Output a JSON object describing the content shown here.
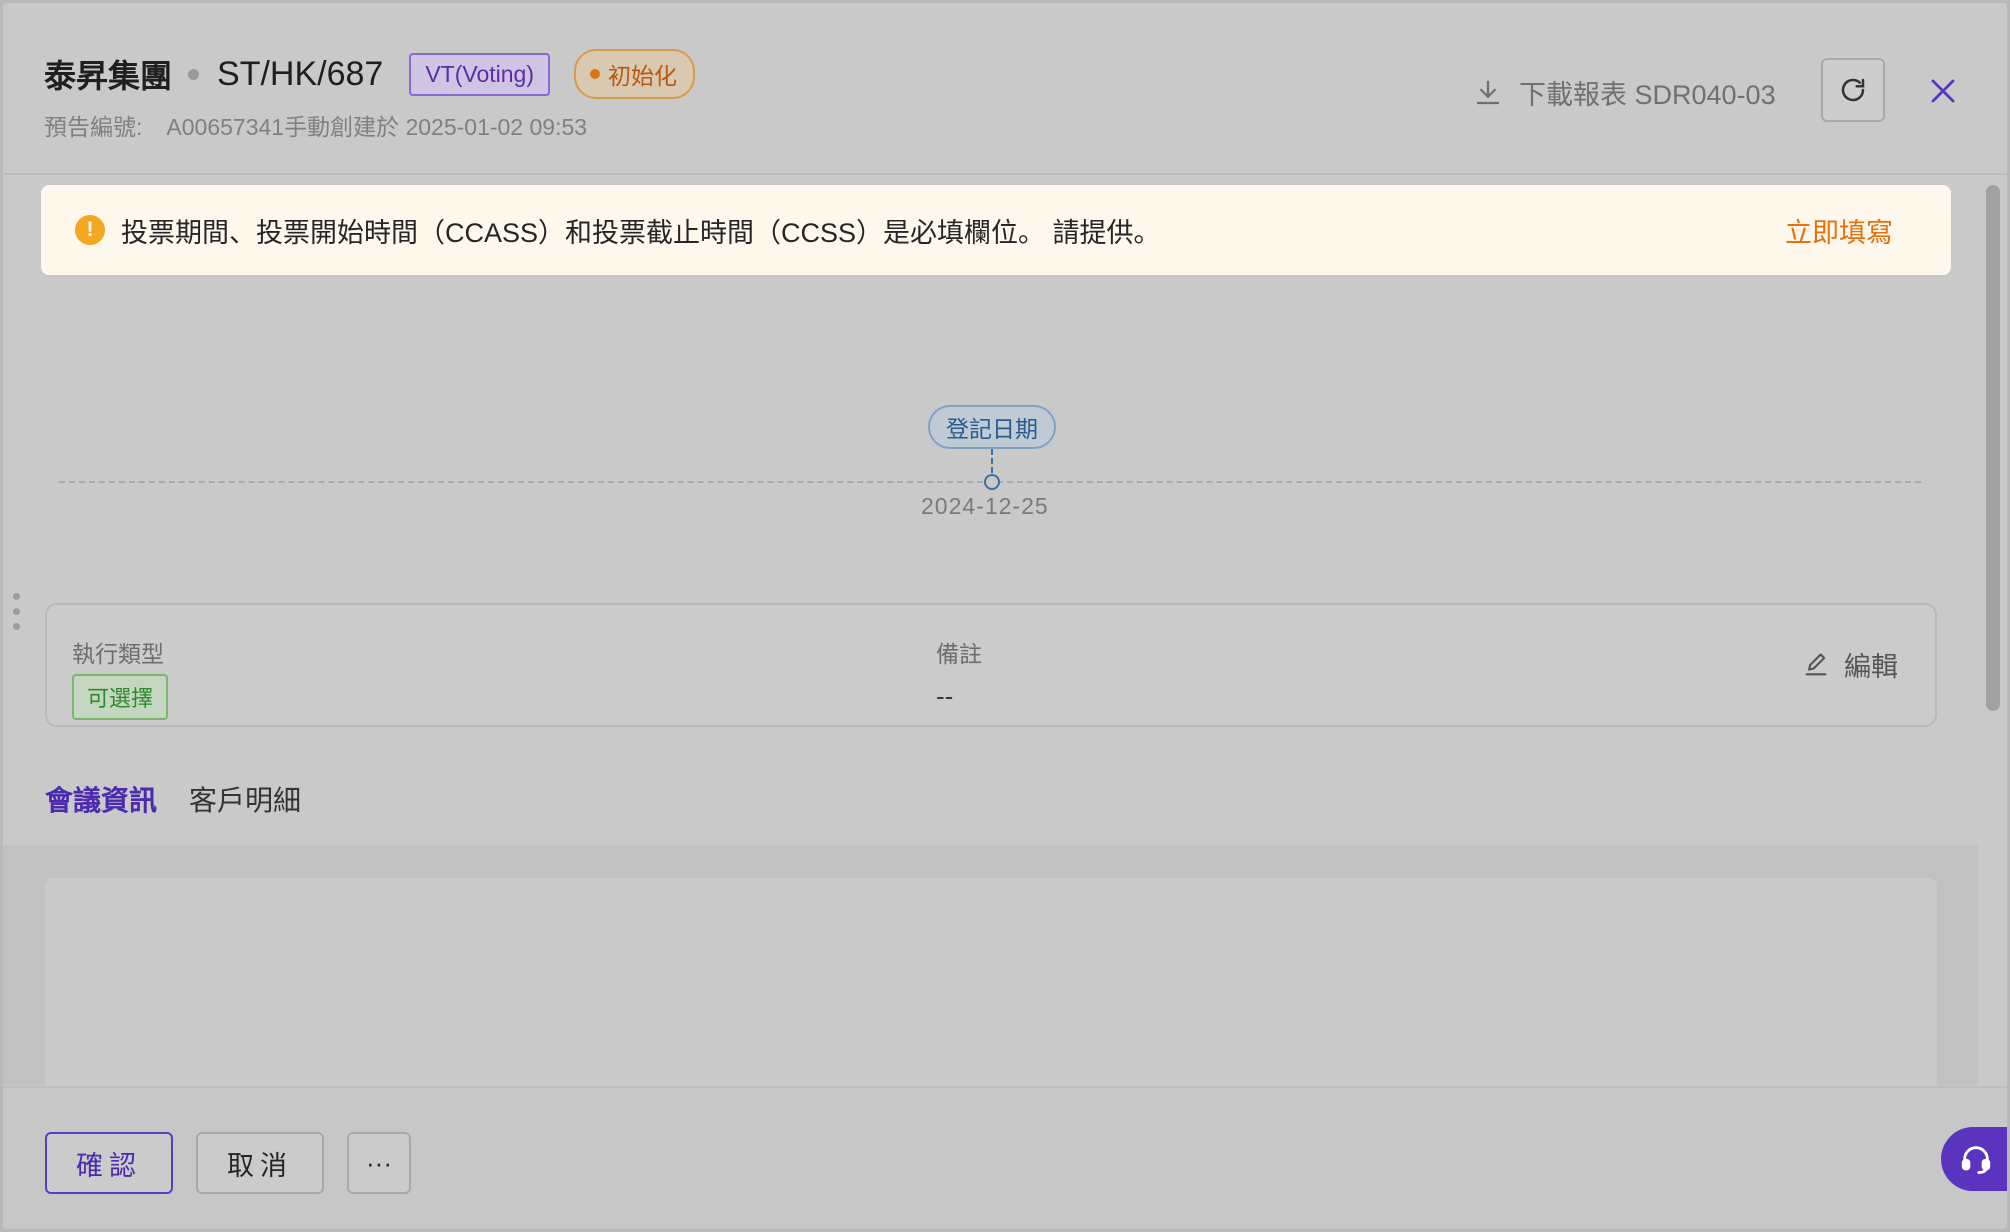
{
  "header": {
    "company": "泰昇集團",
    "code": "ST/HK/687",
    "type_tag": "VT(Voting)",
    "status_tag": "初始化",
    "subtitle_label": "預告編號:",
    "subtitle_value": "A00657341手動創建於 2025-01-02 09:53",
    "download_label": "下載報表 SDR040-03"
  },
  "alert": {
    "message": "投票期間、投票開始時間（CCASS）和投票截止時間（CCSS）是必填欄位。 請提供。",
    "action_label": "立即填寫"
  },
  "timeline": {
    "milestone_label": "登記日期",
    "milestone_date": "2024-12-25"
  },
  "info": {
    "exec_type_label": "執行類型",
    "exec_type_value": "可選擇",
    "remark_label": "備註",
    "remark_value": "--",
    "edit_label": "編輯"
  },
  "tabs": [
    {
      "label": "會議資訊",
      "active": true
    },
    {
      "label": "客戶明細",
      "active": false
    }
  ],
  "footer": {
    "confirm_label": "確認",
    "cancel_label": "取消",
    "more_label": "···"
  },
  "colors": {
    "accent": "#5a35c4",
    "warning": "#e8710a",
    "status_orange": "#d9741a",
    "optional_green": "#2e8a2e",
    "milestone_blue": "#3b6ea3"
  },
  "icons": {
    "download": "download-icon",
    "refresh": "refresh-icon",
    "close": "close-icon",
    "alert": "warning-icon",
    "edit": "edit-icon",
    "support": "headset-icon"
  }
}
